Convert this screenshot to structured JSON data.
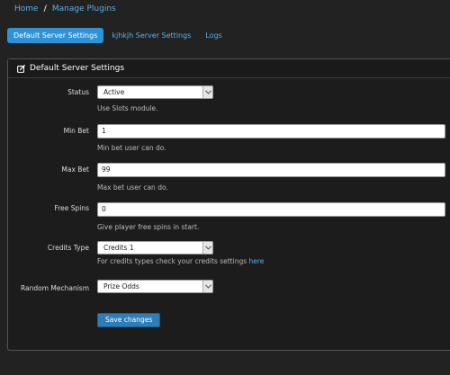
{
  "breadcrumb": {
    "home": "Home",
    "separator": "/",
    "current": "Manage Plugins"
  },
  "tabs": [
    {
      "label": "Default Server Settings",
      "active": true
    },
    {
      "label": "kjhkjh Server Settings",
      "active": false
    },
    {
      "label": "Logs",
      "active": false
    }
  ],
  "panel": {
    "title": "Default Server Settings",
    "icon": "edit-icon",
    "fields": {
      "status": {
        "label": "Status",
        "value": "Active",
        "help": "Use Slots module."
      },
      "min_bet": {
        "label": "Min Bet",
        "value": "1",
        "help": "Min bet user can do."
      },
      "max_bet": {
        "label": "Max Bet",
        "value": "99",
        "help": "Max bet user can do."
      },
      "free_spins": {
        "label": "Free Spins",
        "value": "0",
        "help": "Give player free spins in start."
      },
      "credits_type": {
        "label": "Credits Type",
        "value": "Credits 1",
        "help": "For credits types check your credits settings",
        "help_link": "here"
      },
      "random_mechanism": {
        "label": "Random Mechanism",
        "value": "Prize Odds"
      }
    },
    "save_label": "Save changes"
  },
  "colors": {
    "accent": "#2d93d6",
    "link": "#5bb1e6",
    "background": "#222222",
    "button": "#2d7eb8"
  }
}
